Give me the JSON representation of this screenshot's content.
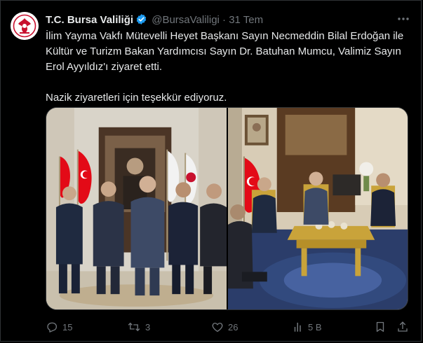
{
  "account": {
    "name": "T.C. Bursa Valiliği",
    "handle": "@BursaValiligi",
    "separator": "·",
    "date": "31 Tem"
  },
  "tweet": {
    "paragraph1": "İlim Yayma Vakfı Mütevelli Heyet Başkanı Sayın Necmeddin Bilal Erdoğan ile Kültür ve Turizm Bakan Yardımcısı Sayın Dr. Batuhan Mumcu, Valimiz Sayın Erol Ayyıldız'ı ziyaret etti.",
    "paragraph2": "Nazik ziyaretleri için teşekkür ediyoruz."
  },
  "metrics": {
    "replies": "15",
    "reposts": "3",
    "likes": "26",
    "views": "5 B"
  },
  "icons": {
    "verified": "verified-badge-icon",
    "more": "more-icon",
    "reply": "reply-icon",
    "repost": "repost-icon",
    "like": "like-icon",
    "views": "views-icon",
    "bookmark": "bookmark-icon",
    "share": "share-icon"
  },
  "colors": {
    "background": "#000000",
    "text": "#e7e9ea",
    "secondary": "#71767b",
    "verified": "#1d9bf0",
    "flag_red": "#e30a17",
    "logo_red": "#c8102e"
  }
}
